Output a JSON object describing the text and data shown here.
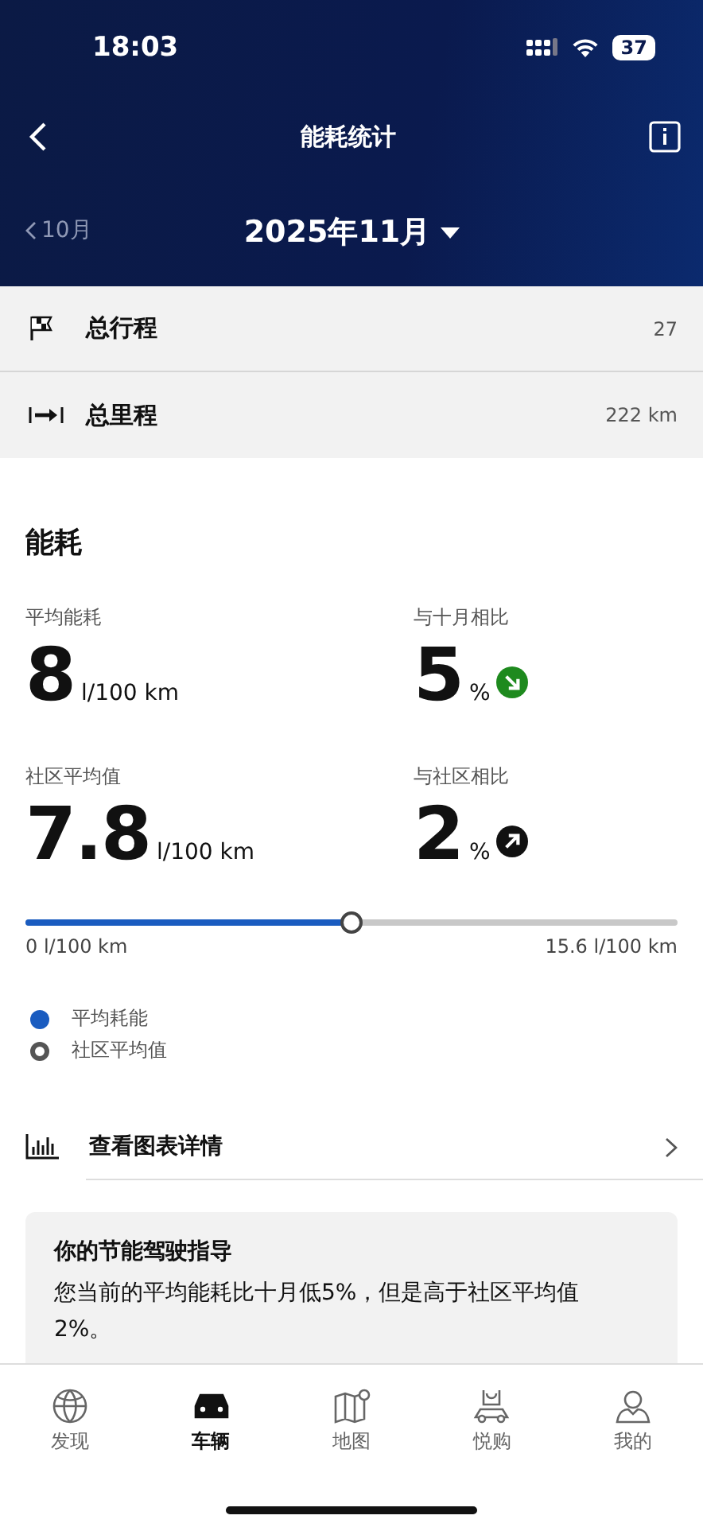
{
  "status_bar": {
    "time": "18:03",
    "battery": "37"
  },
  "header": {
    "title": "能耗统计",
    "prev_month": "10月",
    "month": "2025年11月"
  },
  "summary": [
    {
      "label": "总行程",
      "value": "27"
    },
    {
      "label": "总里程",
      "value": "222 km"
    }
  ],
  "section_title": "能耗",
  "stats": [
    {
      "kind": "value",
      "label": "平均能耗",
      "value": "8",
      "unit": "l/100 km"
    },
    {
      "kind": "decrease",
      "label": "与十月相比",
      "value": "5",
      "unit": "%"
    },
    {
      "kind": "value",
      "label": "社区平均值",
      "value": "7.8",
      "unit": "l/100 km"
    },
    {
      "kind": "increase",
      "label": "与社区相比",
      "value": "2",
      "unit": "%"
    }
  ],
  "gauge": {
    "level": 0.5,
    "min_label": "0 l/100 km",
    "max_label": "15.6 l/100 km"
  },
  "legend": [
    {
      "kind": "dot",
      "label": "平均耗能"
    },
    {
      "kind": "ring",
      "label": "社区平均值"
    }
  ],
  "chart_link": "查看图表详情",
  "tip": {
    "title": "你的节能驾驶指导",
    "text": "您当前的平均能耗比十月低5%，但是高于社区平均值2%。"
  },
  "tabs": [
    {
      "label": "发现",
      "selected": false
    },
    {
      "label": "车辆",
      "selected": true
    },
    {
      "label": "地图",
      "selected": false
    },
    {
      "label": "悦购",
      "selected": false
    },
    {
      "label": "我的",
      "selected": false
    }
  ]
}
